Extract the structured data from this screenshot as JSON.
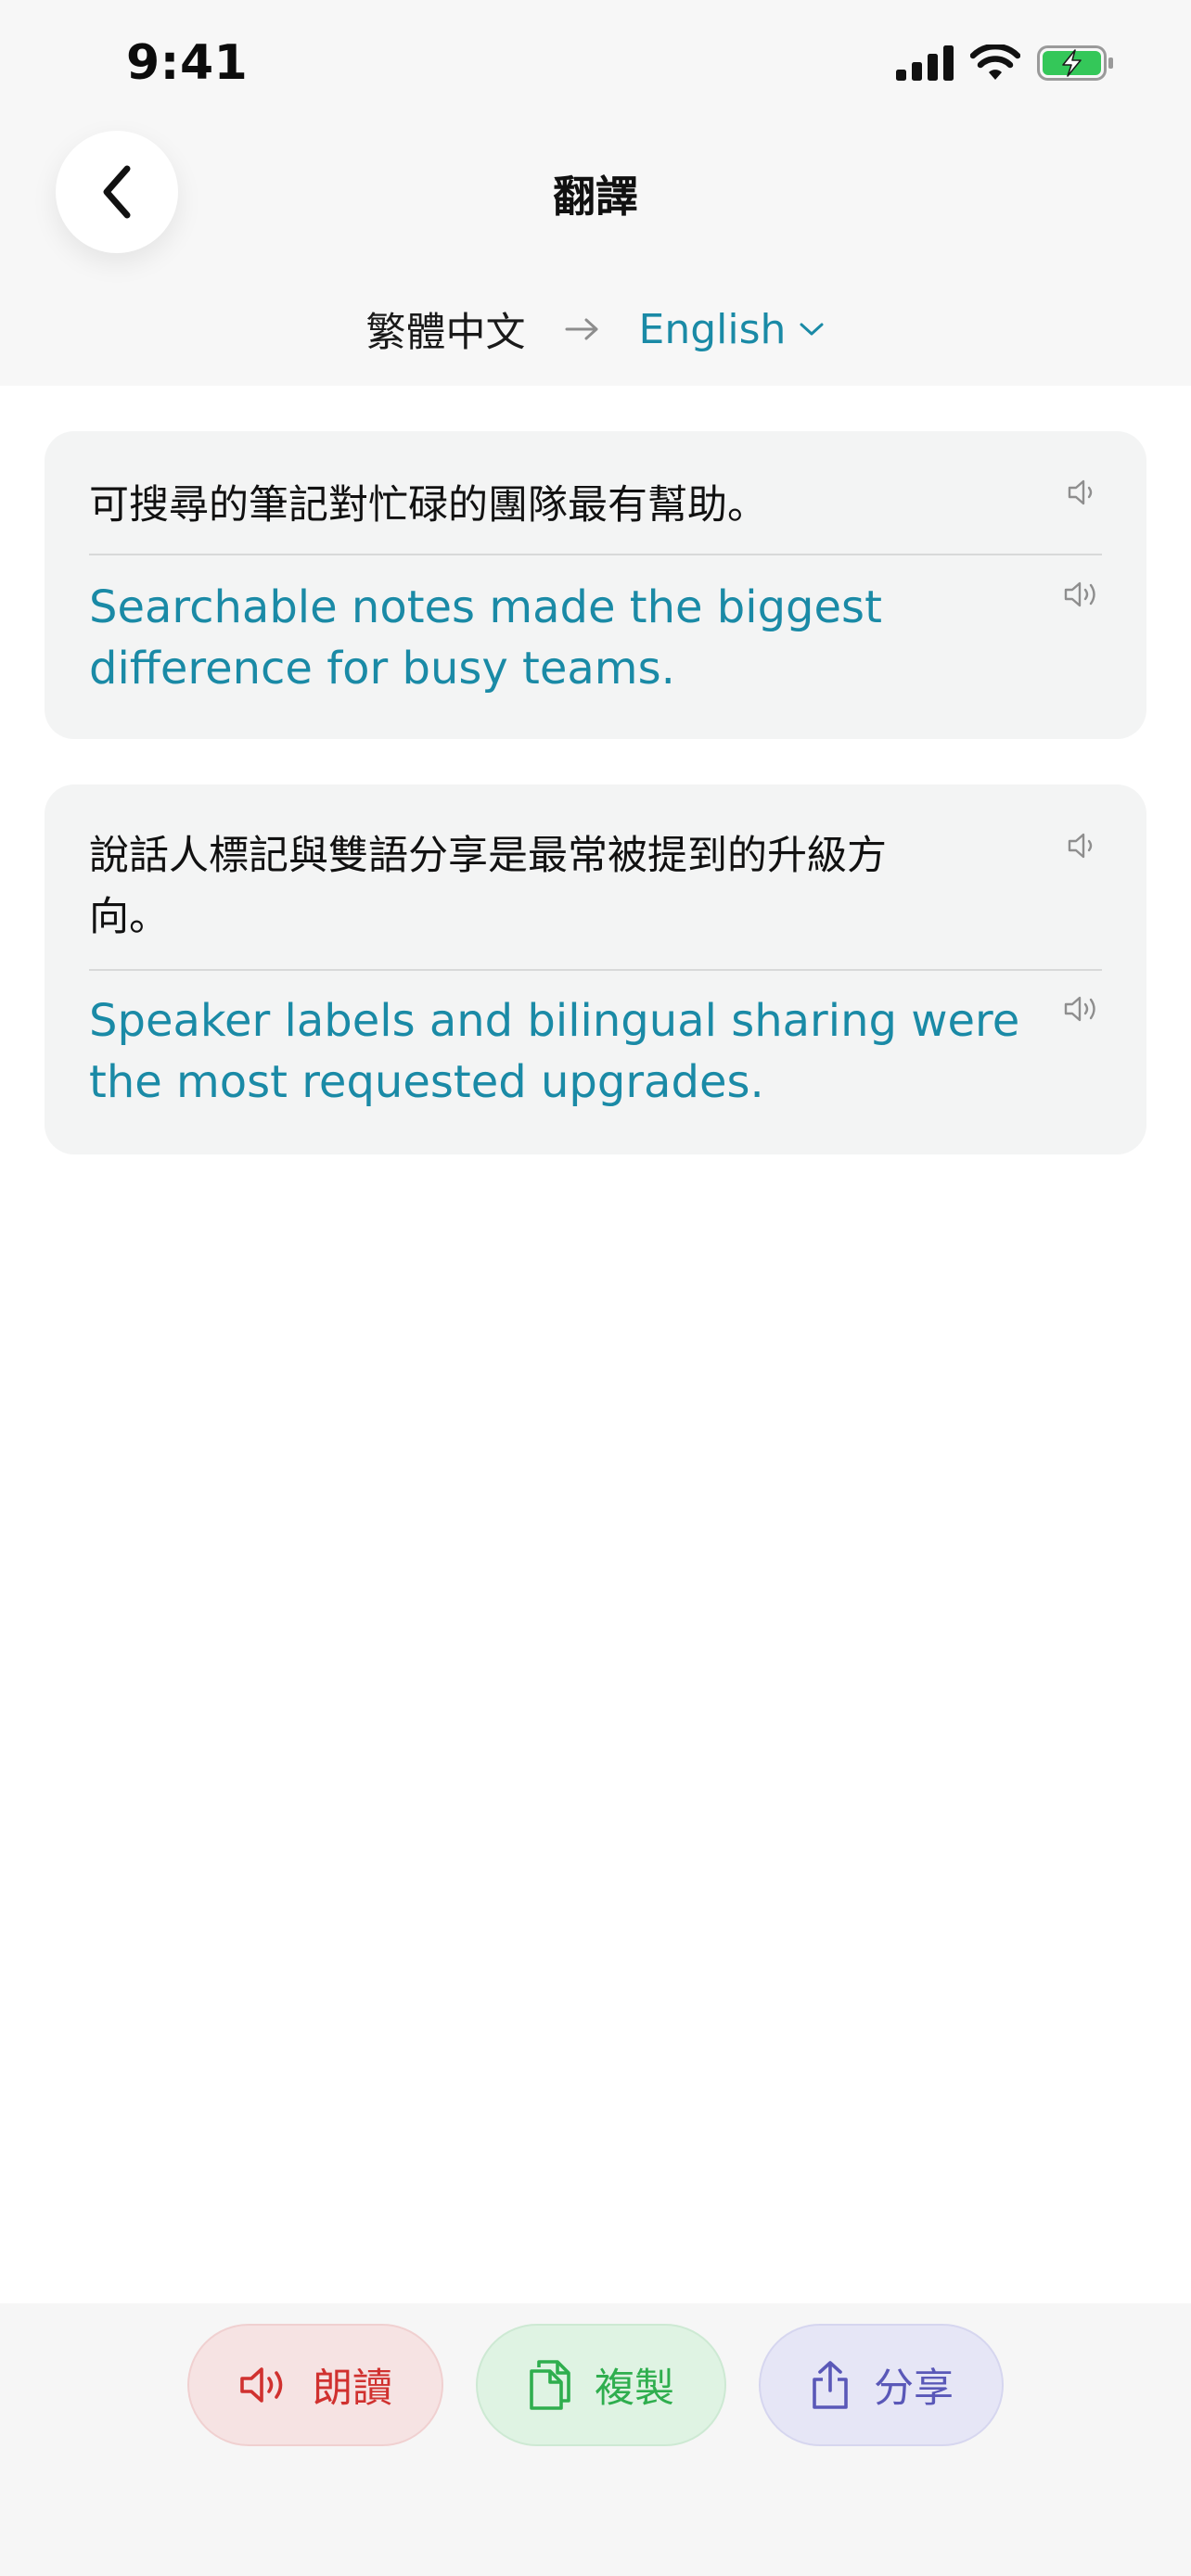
{
  "status_bar": {
    "time": "9:41",
    "icons": [
      "signal-icon",
      "wifi-icon",
      "battery-charging-icon"
    ]
  },
  "header": {
    "title": "翻譯",
    "back_icon": "chevron-left-icon"
  },
  "languages": {
    "source": "繁體中文",
    "target": "English",
    "arrow_icon": "arrow-right-icon",
    "target_dropdown_icon": "chevron-down-icon"
  },
  "cards": [
    {
      "source_text": "可搜尋的筆記對忙碌的團隊最有幫助。",
      "translation": "Searchable notes made the biggest difference for busy teams."
    },
    {
      "source_text": "說話人標記與雙語分享是最常被提到的升級方向。",
      "translation": "Speaker labels and bilingual sharing were the most requested upgrades."
    }
  ],
  "actions": {
    "read_label": "朗讀",
    "copy_label": "複製",
    "share_label": "分享"
  },
  "colors": {
    "accent": "#1a8aa6",
    "read": "#d0312f",
    "copy": "#2fae4e",
    "share": "#5a58b8"
  }
}
